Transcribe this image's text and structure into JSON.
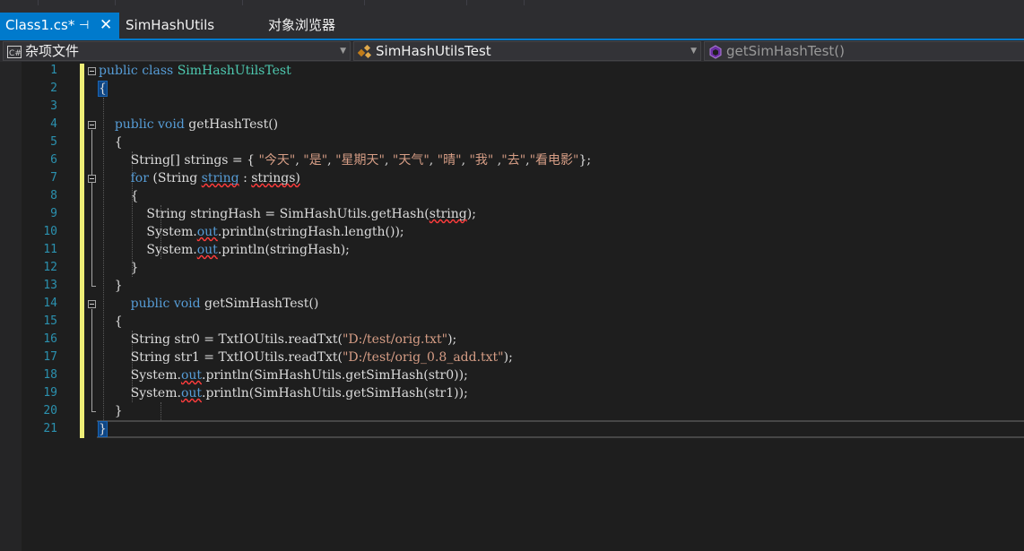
{
  "tabs": {
    "active": {
      "label": "Class1.cs*",
      "pin_icon": "pin-icon",
      "close_glyph": "✕"
    },
    "second": {
      "label": "SimHashUtils"
    },
    "third": {
      "label": "对象浏览器"
    }
  },
  "navbar": {
    "project": {
      "label": "杂项文件",
      "icon": "csharp-file-icon"
    },
    "type": {
      "label": "SimHashUtilsTest",
      "icon": "class-icon"
    },
    "member": {
      "label": "getSimHashTest()",
      "icon": "method-icon"
    }
  },
  "editor": {
    "line_numbers": [
      "1",
      "2",
      "3",
      "4",
      "5",
      "6",
      "7",
      "8",
      "9",
      "10",
      "11",
      "12",
      "13",
      "14",
      "15",
      "16",
      "17",
      "18",
      "19",
      "20",
      "21"
    ],
    "lines": [
      {
        "segs": [
          {
            "c": "kw",
            "t": "public"
          },
          {
            "c": "pl",
            "t": " "
          },
          {
            "c": "kw",
            "t": "class"
          },
          {
            "c": "pl",
            "t": " "
          },
          {
            "c": "ty",
            "t": "SimHashUtilsTest"
          }
        ]
      },
      {
        "segs": [
          {
            "c": "pl",
            "t": "{",
            "hl": true
          }
        ]
      },
      {
        "segs": []
      },
      {
        "segs": [
          {
            "c": "pl",
            "t": "    "
          },
          {
            "c": "kw",
            "t": "public"
          },
          {
            "c": "pl",
            "t": " "
          },
          {
            "c": "kw",
            "t": "void"
          },
          {
            "c": "pl",
            "t": " getHashTest()"
          }
        ]
      },
      {
        "segs": [
          {
            "c": "pl",
            "t": "    {"
          }
        ]
      },
      {
        "segs": [
          {
            "c": "pl",
            "t": "        String[] strings = { "
          },
          {
            "c": "str",
            "t": "\"今天\""
          },
          {
            "c": "pl",
            "t": ", "
          },
          {
            "c": "str",
            "t": "\"是\""
          },
          {
            "c": "pl",
            "t": ", "
          },
          {
            "c": "str",
            "t": "\"星期天\""
          },
          {
            "c": "pl",
            "t": ", "
          },
          {
            "c": "str",
            "t": "\"天气\""
          },
          {
            "c": "pl",
            "t": ", "
          },
          {
            "c": "str",
            "t": "\"晴\""
          },
          {
            "c": "pl",
            "t": ", "
          },
          {
            "c": "str",
            "t": "\"我\""
          },
          {
            "c": "pl",
            "t": " ,"
          },
          {
            "c": "str",
            "t": "\"去\""
          },
          {
            "c": "pl",
            "t": ","
          },
          {
            "c": "str",
            "t": "\"看电影\""
          },
          {
            "c": "pl",
            "t": "};"
          }
        ]
      },
      {
        "segs": [
          {
            "c": "pl",
            "t": "        "
          },
          {
            "c": "kw",
            "t": "for"
          },
          {
            "c": "pl",
            "t": " (String "
          },
          {
            "c": "kw",
            "t": "string",
            "sq": true
          },
          {
            "c": "pl",
            "t": " : "
          },
          {
            "c": "pl",
            "t": "strings)",
            "sq": true
          }
        ]
      },
      {
        "segs": [
          {
            "c": "pl",
            "t": "        {"
          }
        ]
      },
      {
        "segs": [
          {
            "c": "pl",
            "t": "            String stringHash = SimHashUtils.getHash("
          },
          {
            "c": "pl",
            "t": "string",
            "sq": true
          },
          {
            "c": "pl",
            "t": ");"
          }
        ]
      },
      {
        "segs": [
          {
            "c": "pl",
            "t": "            System."
          },
          {
            "c": "fld",
            "t": "out",
            "sq": true
          },
          {
            "c": "pl",
            "t": ".println(stringHash.length());"
          }
        ]
      },
      {
        "segs": [
          {
            "c": "pl",
            "t": "            System."
          },
          {
            "c": "fld",
            "t": "out",
            "sq": true
          },
          {
            "c": "pl",
            "t": ".println(stringHash);"
          }
        ]
      },
      {
        "segs": [
          {
            "c": "pl",
            "t": "        }"
          }
        ]
      },
      {
        "segs": [
          {
            "c": "pl",
            "t": "    }"
          }
        ]
      },
      {
        "segs": [
          {
            "c": "pl",
            "t": "        "
          },
          {
            "c": "kw",
            "t": "public"
          },
          {
            "c": "pl",
            "t": " "
          },
          {
            "c": "kw",
            "t": "void"
          },
          {
            "c": "pl",
            "t": " getSimHashTest()"
          }
        ]
      },
      {
        "segs": [
          {
            "c": "pl",
            "t": "    {"
          }
        ]
      },
      {
        "segs": [
          {
            "c": "pl",
            "t": "        String str0 = TxtIOUtils.readTxt("
          },
          {
            "c": "str",
            "t": "\"D:/test/orig.txt\""
          },
          {
            "c": "pl",
            "t": ");"
          }
        ]
      },
      {
        "segs": [
          {
            "c": "pl",
            "t": "        String str1 = TxtIOUtils.readTxt("
          },
          {
            "c": "str",
            "t": "\"D:/test/orig_0.8_add.txt\""
          },
          {
            "c": "pl",
            "t": ");"
          }
        ]
      },
      {
        "segs": [
          {
            "c": "pl",
            "t": "        System."
          },
          {
            "c": "fld",
            "t": "out",
            "sq": true
          },
          {
            "c": "pl",
            "t": ".println(SimHashUtils.getSimHash(str0));"
          }
        ]
      },
      {
        "segs": [
          {
            "c": "pl",
            "t": "        System."
          },
          {
            "c": "fld",
            "t": "out",
            "sq": true
          },
          {
            "c": "pl",
            "t": ".println(SimHashUtils.getSimHash(str1));"
          }
        ]
      },
      {
        "segs": [
          {
            "c": "pl",
            "t": "    }"
          }
        ]
      },
      {
        "segs": [
          {
            "c": "pl",
            "t": "}",
            "hl": true
          }
        ]
      }
    ]
  },
  "colors": {
    "accent": "#007acc",
    "keyword": "#569cd6",
    "type": "#4ec9b0",
    "string": "#d69d85",
    "line_number": "#2b91af",
    "change_bar": "#eeee77"
  }
}
